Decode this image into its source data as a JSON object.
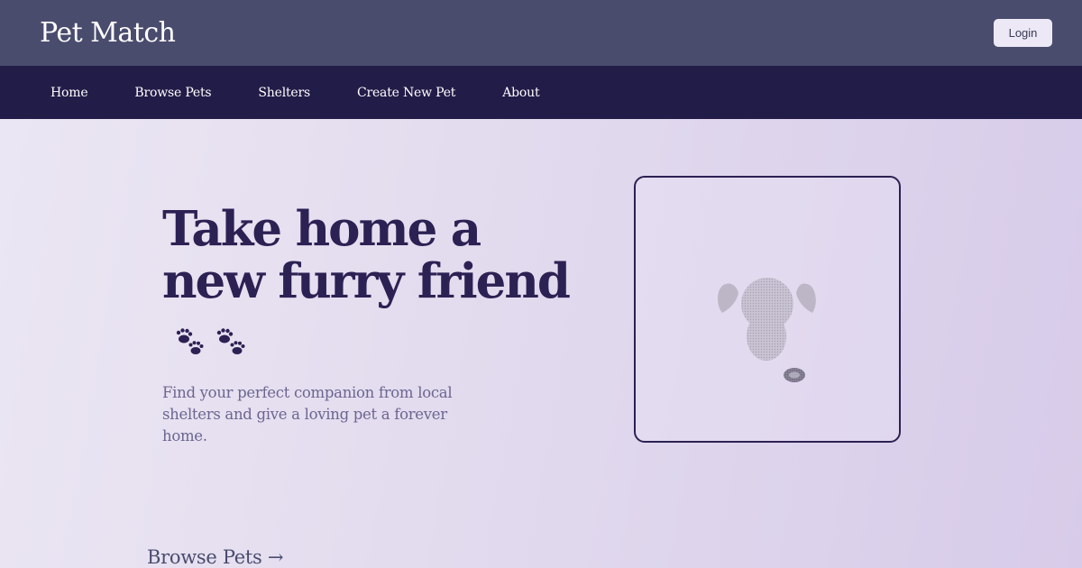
{
  "app": {
    "title": "Pet Match"
  },
  "header": {
    "login_label": "Login"
  },
  "nav": {
    "items": [
      {
        "label": "Home"
      },
      {
        "label": "Browse Pets"
      },
      {
        "label": "Shelters"
      },
      {
        "label": "Create New Pet"
      },
      {
        "label": "About"
      }
    ]
  },
  "hero": {
    "title_line1": "Take home a",
    "title_line2": "new furry friend",
    "subtitle": "Find your perfect companion from local shelters and give a loving pet a forever home.",
    "decoration_icon": "paw-prints-icon",
    "image_icon": "dog-placeholder-icon"
  },
  "browse": {
    "label": "Browse Pets →"
  },
  "colors": {
    "topbar": "#4a4c6e",
    "navbar": "#221c48",
    "title": "#2c2153",
    "subtitle": "#6c6690",
    "hero_bg_start": "#ebe6f3",
    "hero_bg_end": "#d7cbe9"
  }
}
